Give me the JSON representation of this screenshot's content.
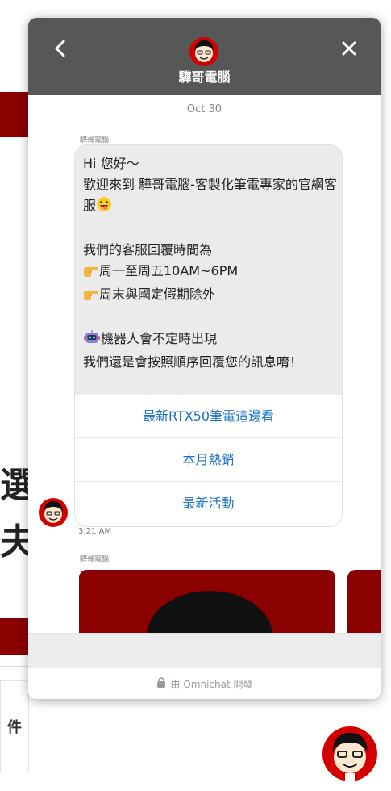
{
  "background": {
    "chars": [
      "選",
      "夫"
    ],
    "card_char": "件"
  },
  "header": {
    "title": "驊哥電腦",
    "back_icon": "chevron-left-icon",
    "close_icon": "close-icon",
    "avatar_icon": "cartoon-avatar-icon"
  },
  "chat": {
    "date": "Oct 30",
    "sender": "驊哥電腦",
    "message": {
      "line1": "Hi 您好～",
      "line2": "歡迎來到 驊哥電腦-客製化筆電專家的官網客服",
      "line3": "我們的客服回覆時間為",
      "line4": "周一至周五10AM~6PM",
      "line5": "周末與國定假期除外",
      "line6": "機器人會不定時出現",
      "line7": "我們還是會按照順序回覆您的訊息唷！"
    },
    "quick_replies": [
      "最新RTX50筆電這邊看",
      "本月熱銷",
      "最新活動"
    ],
    "time": "3:21 AM",
    "sender2": "驊哥電腦"
  },
  "footer": {
    "powered_by": "由 Omnichat 開發"
  },
  "colors": {
    "header_bg": "#575757",
    "brand_red": "#8b0000",
    "link_blue": "#1a72c4",
    "bubble_bg": "#ebebeb"
  }
}
